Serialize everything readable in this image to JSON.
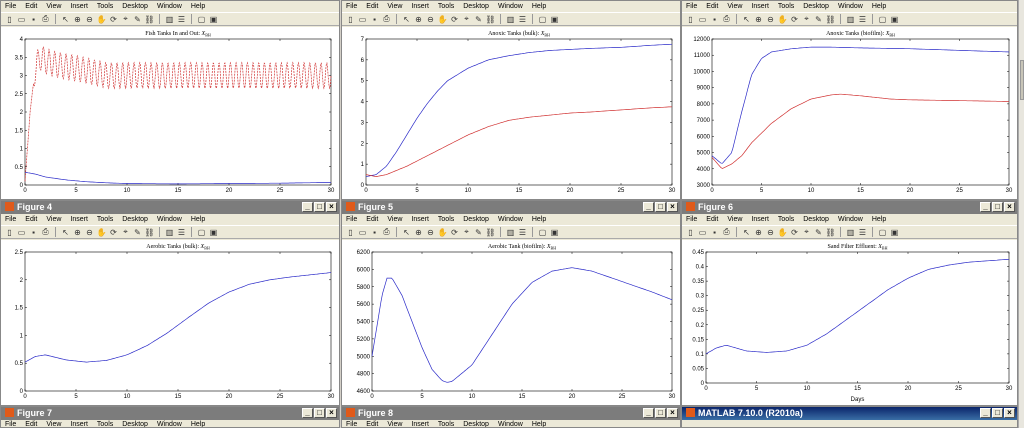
{
  "menu": [
    "File",
    "Edit",
    "View",
    "Insert",
    "Tools",
    "Desktop",
    "Window",
    "Help"
  ],
  "toolbar_icons": [
    "new-file-icon",
    "open-folder-icon",
    "save-icon",
    "print-icon",
    "pointer-icon",
    "zoom-in-icon",
    "zoom-out-icon",
    "pan-icon",
    "rotate-icon",
    "data-cursor-icon",
    "brush-icon",
    "link-icon",
    "colorbar-icon",
    "legend-icon",
    "hide-plot-tools-icon",
    "show-plot-tools-icon"
  ],
  "taskbar": {
    "label": "MATLAB 7.10.0 (R2010a)"
  },
  "colors": {
    "blue": "#2a2ac8",
    "red": "#d03030"
  },
  "figures": [
    {
      "id": "top-left",
      "window_title": "",
      "title": "Fish Tanks In and Out: ",
      "title_sub": "X_{BH}",
      "x_ticks": [
        0,
        5,
        10,
        15,
        20,
        25,
        30
      ],
      "y_ticks": [
        0,
        0.5,
        1,
        1.5,
        2,
        2.5,
        3,
        3.5,
        4
      ],
      "y_tick_labels": [
        "0",
        "0.5",
        "1",
        "1.5",
        "2",
        "2.5",
        "3",
        "3.5",
        "4"
      ],
      "ylim": [
        0,
        4
      ],
      "xlabel": ""
    },
    {
      "id": "top-mid",
      "window_title": "",
      "title": "Anoxic Tanks (bulk): ",
      "title_sub": "X_{BH}",
      "x_ticks": [
        0,
        5,
        10,
        15,
        20,
        25,
        30
      ],
      "y_ticks": [
        0,
        1,
        2,
        3,
        4,
        5,
        6,
        7
      ],
      "y_tick_labels": [
        "0",
        "1",
        "2",
        "3",
        "4",
        "5",
        "6",
        "7"
      ],
      "ylim": [
        0,
        7
      ],
      "xlabel": ""
    },
    {
      "id": "top-right",
      "window_title": "",
      "title": "Anoxic Tanks (biofilm): ",
      "title_sub": "X_{BH}",
      "x_ticks": [
        0,
        5,
        10,
        15,
        20,
        25,
        30
      ],
      "y_ticks": [
        3000,
        4000,
        5000,
        6000,
        7000,
        8000,
        9000,
        10000,
        11000,
        12000
      ],
      "y_tick_labels": [
        "3000",
        "4000",
        "5000",
        "6000",
        "7000",
        "8000",
        "9000",
        "10000",
        "11000",
        "12000"
      ],
      "ylim": [
        3000,
        12000
      ],
      "xlabel": ""
    },
    {
      "id": "mid-left",
      "window_title": "Figure 4",
      "title": "Aerobic Tanks (bulk): ",
      "title_sub": "X_{BH}",
      "x_ticks": [
        0,
        5,
        10,
        15,
        20,
        25,
        30
      ],
      "y_ticks": [
        0,
        0.5,
        1,
        1.5,
        2,
        2.5
      ],
      "y_tick_labels": [
        "0",
        "0.5",
        "1",
        "1.5",
        "2",
        "2.5"
      ],
      "ylim": [
        0,
        2.5
      ],
      "xlabel": ""
    },
    {
      "id": "mid-mid",
      "window_title": "Figure 5",
      "title": "Aerobic Tank (biofilm): ",
      "title_sub": "X_{BH}",
      "x_ticks": [
        0,
        5,
        10,
        15,
        20,
        25,
        30
      ],
      "y_ticks": [
        4600,
        4800,
        5000,
        5200,
        5400,
        5600,
        5800,
        6000,
        6200
      ],
      "y_tick_labels": [
        "4600",
        "4800",
        "5000",
        "5200",
        "5400",
        "5600",
        "5800",
        "6000",
        "6200"
      ],
      "ylim": [
        4600,
        6200
      ],
      "xlabel": ""
    },
    {
      "id": "mid-right",
      "window_title": "Figure 6",
      "title": "Sand Filter Effluent: ",
      "title_sub": "X_{BH}",
      "x_ticks": [
        0,
        5,
        10,
        15,
        20,
        25,
        30
      ],
      "y_ticks": [
        0,
        0.05,
        0.1,
        0.15,
        0.2,
        0.25,
        0.3,
        0.35,
        0.4,
        0.45
      ],
      "y_tick_labels": [
        "0",
        "0.05",
        "0.1",
        "0.15",
        "0.2",
        "0.25",
        "0.3",
        "0.35",
        "0.4",
        "0.45"
      ],
      "ylim": [
        0,
        0.45
      ],
      "xlabel": "Days"
    }
  ],
  "bottom_windows": [
    {
      "window_title": "Figure 7"
    },
    {
      "window_title": "Figure 8"
    }
  ],
  "chart_data": [
    {
      "type": "line",
      "title": "Fish Tanks In and Out: X_BH",
      "xlim": [
        0,
        30
      ],
      "ylim": [
        0,
        4
      ],
      "series": [
        {
          "color": "red",
          "style": "dashed",
          "x": [
            0,
            0.5,
            1,
            1.5,
            2,
            3,
            5,
            8,
            12,
            16,
            20,
            25,
            30
          ],
          "y": [
            0.1,
            2.0,
            3.2,
            3.5,
            3.4,
            3.3,
            3.2,
            3.0,
            3.0,
            3.0,
            3.0,
            3.0,
            3.0
          ],
          "oscillation": 0.35
        },
        {
          "color": "blue",
          "x": [
            0,
            1,
            2,
            4,
            6,
            8,
            10,
            15,
            20,
            25,
            30
          ],
          "y": [
            0.35,
            0.3,
            0.22,
            0.14,
            0.09,
            0.06,
            0.04,
            0.03,
            0.04,
            0.05,
            0.07
          ]
        }
      ]
    },
    {
      "type": "line",
      "title": "Anoxic Tanks (bulk): X_BH",
      "xlim": [
        0,
        30
      ],
      "ylim": [
        0,
        7
      ],
      "series": [
        {
          "color": "blue",
          "x": [
            0,
            1,
            2,
            3,
            4,
            5,
            6,
            7,
            8,
            10,
            12,
            14,
            16,
            18,
            20,
            22,
            25,
            28,
            30
          ],
          "y": [
            0.4,
            0.5,
            0.9,
            1.6,
            2.4,
            3.2,
            3.9,
            4.5,
            5.0,
            5.6,
            6.0,
            6.2,
            6.35,
            6.45,
            6.5,
            6.55,
            6.6,
            6.7,
            6.75
          ]
        },
        {
          "color": "red",
          "x": [
            0,
            1,
            2,
            4,
            6,
            8,
            10,
            12,
            14,
            16,
            18,
            20,
            22,
            25,
            28,
            30
          ],
          "y": [
            0.5,
            0.4,
            0.5,
            0.9,
            1.4,
            1.9,
            2.4,
            2.8,
            3.1,
            3.25,
            3.35,
            3.45,
            3.5,
            3.6,
            3.7,
            3.75
          ]
        }
      ]
    },
    {
      "type": "line",
      "title": "Anoxic Tanks (biofilm): X_BH",
      "xlim": [
        0,
        30
      ],
      "ylim": [
        3000,
        12000
      ],
      "series": [
        {
          "color": "blue",
          "x": [
            0,
            1,
            2,
            3,
            4,
            5,
            6,
            8,
            10,
            12,
            15,
            20,
            25,
            30
          ],
          "y": [
            4800,
            4300,
            5000,
            7500,
            9800,
            10800,
            11200,
            11400,
            11500,
            11500,
            11450,
            11400,
            11300,
            11200
          ]
        },
        {
          "color": "red",
          "x": [
            0,
            1,
            2,
            3,
            4,
            6,
            8,
            10,
            12,
            13,
            15,
            18,
            20,
            25,
            30
          ],
          "y": [
            4700,
            4000,
            4300,
            4800,
            5600,
            6800,
            7700,
            8300,
            8550,
            8600,
            8500,
            8300,
            8250,
            8200,
            8150
          ]
        }
      ]
    },
    {
      "type": "line",
      "title": "Aerobic Tanks (bulk): X_BH",
      "xlim": [
        0,
        30
      ],
      "ylim": [
        0,
        2.5
      ],
      "series": [
        {
          "color": "blue",
          "x": [
            0,
            1,
            2,
            4,
            6,
            8,
            10,
            12,
            14,
            16,
            18,
            20,
            22,
            24,
            26,
            28,
            30
          ],
          "y": [
            0.52,
            0.62,
            0.65,
            0.56,
            0.52,
            0.55,
            0.65,
            0.82,
            1.05,
            1.32,
            1.58,
            1.78,
            1.92,
            2.0,
            2.05,
            2.09,
            2.13
          ]
        }
      ]
    },
    {
      "type": "line",
      "title": "Aerobic Tank (biofilm): X_BH",
      "xlim": [
        0,
        30
      ],
      "ylim": [
        4600,
        6200
      ],
      "series": [
        {
          "color": "blue",
          "x": [
            0,
            1,
            1.5,
            2,
            3,
            4,
            5,
            6,
            7,
            7.5,
            8,
            10,
            12,
            14,
            16,
            18,
            20,
            22,
            24,
            26,
            28,
            30
          ],
          "y": [
            5000,
            5700,
            5900,
            5900,
            5700,
            5400,
            5100,
            4850,
            4720,
            4700,
            4710,
            4900,
            5250,
            5600,
            5850,
            5980,
            6020,
            5980,
            5900,
            5820,
            5740,
            5650
          ]
        }
      ]
    },
    {
      "type": "line",
      "title": "Sand Filter Effluent: X_BH",
      "xlabel": "Days",
      "xlim": [
        0,
        30
      ],
      "ylim": [
        0,
        0.45
      ],
      "series": [
        {
          "color": "blue",
          "x": [
            0,
            1,
            2,
            3,
            4,
            6,
            8,
            10,
            12,
            14,
            16,
            18,
            20,
            22,
            24,
            26,
            28,
            30
          ],
          "y": [
            0.1,
            0.12,
            0.13,
            0.12,
            0.11,
            0.105,
            0.11,
            0.13,
            0.17,
            0.22,
            0.27,
            0.32,
            0.36,
            0.39,
            0.405,
            0.415,
            0.42,
            0.425
          ]
        }
      ]
    }
  ]
}
